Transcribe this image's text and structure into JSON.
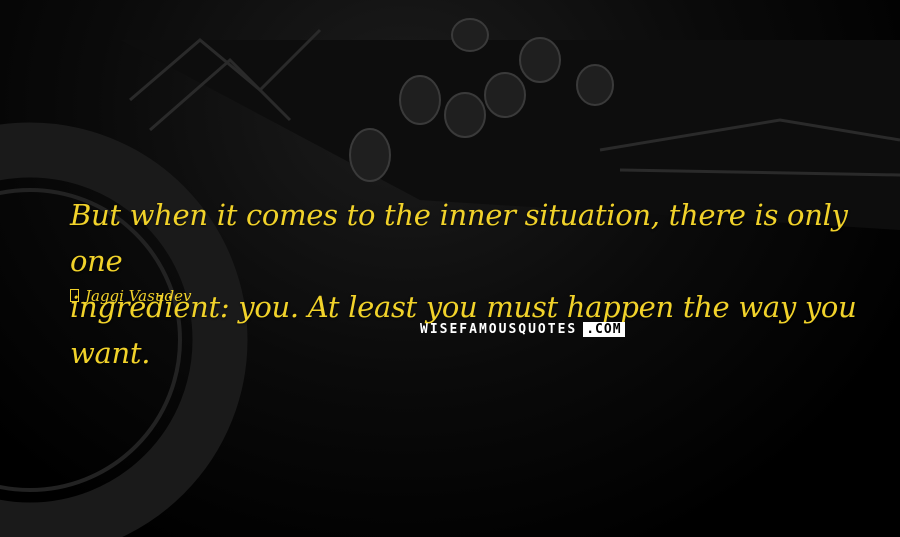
{
  "quote": {
    "line1": "But when it comes to the inner situation, there is only one",
    "line2": "ingredient: you. At least you must happen the way you want.",
    "author": "Jaggi Vasudev",
    "text_color": "#f1d22a"
  },
  "watermark": {
    "text": "WISEFAMOUSQUOTES",
    "suffix": ".COM"
  }
}
